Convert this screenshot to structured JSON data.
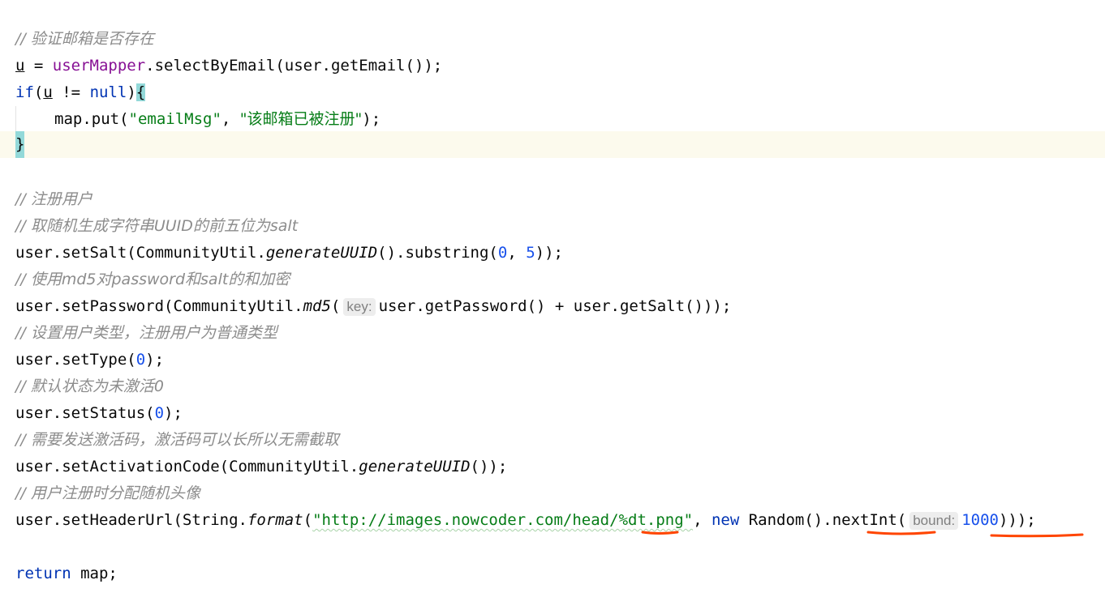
{
  "code": {
    "comment_verify_email": "// 验证邮箱是否存在",
    "u_var": "u",
    "eq": " = ",
    "user_mapper": "userMapper",
    "select_call": ".selectByEmail(user.getEmail());",
    "if_kw": "if",
    "if_open": "(",
    "not_null": " != ",
    "null_kw": "null",
    "if_close": ")",
    "brace_open": "{",
    "map_put_start": "map.put(",
    "email_key": "\"emailMsg\"",
    "comma": ", ",
    "email_msg_str": "\"该邮箱已被注册\"",
    "map_put_end": ");",
    "brace_close": "}",
    "comment_register": "// 注册用户",
    "comment_salt": "// 取随机生成字符串UUID的前五位为salt",
    "set_salt_start": "user.setSalt(CommunityUtil.",
    "generate_uuid": "generateUUID",
    "substring_part": "().substring(",
    "num_0": "0",
    "num_5": "5",
    "set_salt_end": "));",
    "comment_md5": "// 使用md5对password和salt的和加密",
    "set_password_start": "user.setPassword(CommunityUtil.",
    "md5": "md5",
    "paren_open": "(",
    "hint_key": "key:",
    "set_password_end": "user.getPassword() + user.getSalt()));",
    "comment_type": "// 设置用户类型，注册用户为普通类型",
    "set_type_start": "user.setType(",
    "set_type_end": ");",
    "comment_status": "// 默认状态为未激活0",
    "set_status_start": "user.setStatus(",
    "set_status_end": ");",
    "comment_activation": "// 需要发送激活码，激活码可以长所以无需截取",
    "set_activation_start": "user.setActivationCode(CommunityUtil.",
    "set_activation_end": "());",
    "comment_header": "// 用户注册时分配随机头像",
    "set_header_start": "user.setHeaderUrl(String.",
    "format": "format",
    "url_str": "\"http://images.nowcoder.com/head/%dt.png\"",
    "new_kw": "new",
    "random_call": " Random()",
    "next_int": ".nextInt",
    "hint_bound": "bound:",
    "num_1000": "1000",
    "header_end": ")));",
    "return_kw": "return",
    "return_rest": " map;"
  },
  "colors": {
    "keyword": "#0033b3",
    "field": "#871094",
    "string": "#067d17",
    "number": "#1750eb",
    "comment": "#8c8c8c",
    "brace_match": "#93d9d9",
    "current_line": "#fcfaed",
    "annotation_underline": "#ff4500"
  }
}
